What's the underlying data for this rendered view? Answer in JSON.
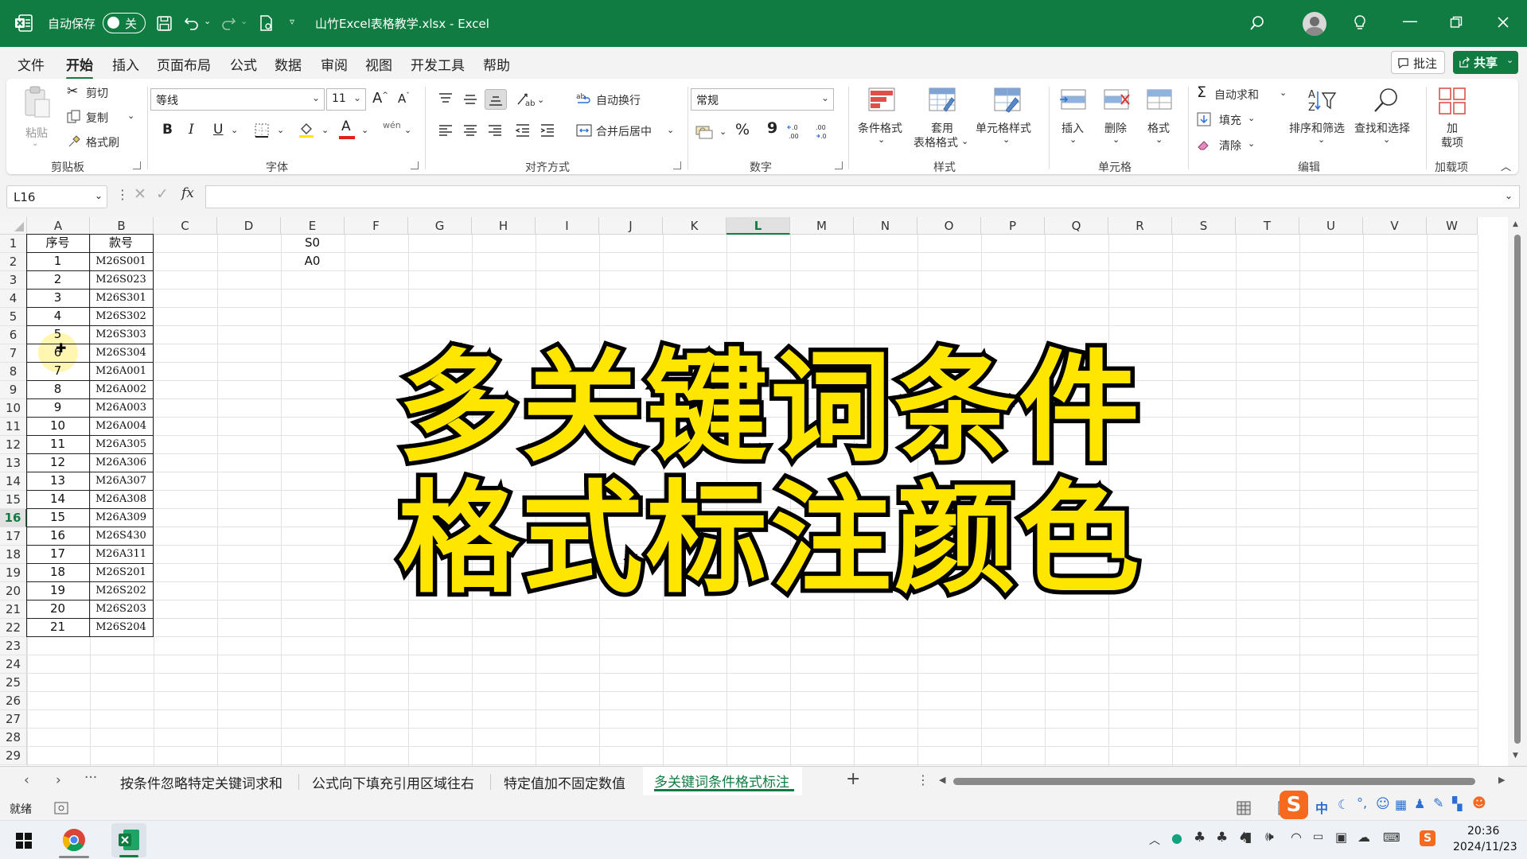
{
  "window": {
    "autosave_label": "自动保存",
    "autosave_state": "关",
    "file_title": "山竹Excel表格教学.xlsx  -  Excel"
  },
  "menu": [
    "文件",
    "开始",
    "插入",
    "页面布局",
    "公式",
    "数据",
    "审阅",
    "视图",
    "开发工具",
    "帮助"
  ],
  "menu_right": {
    "comment": "批注",
    "share": "共享"
  },
  "ribbon": {
    "clipboard": {
      "paste": "粘贴",
      "cut": "剪切",
      "copy": "复制",
      "format_painter": "格式刷",
      "group": "剪贴板"
    },
    "font": {
      "name": "等线",
      "size": "11",
      "bold": "B",
      "italic": "I",
      "underline": "U",
      "wen": "wén",
      "group": "字体"
    },
    "alignment": {
      "wrap": "自动换行",
      "merge": "合并后居中",
      "group": "对齐方式"
    },
    "number": {
      "format": "常规",
      "percent": "%",
      "comma": "9",
      "group": "数字"
    },
    "styles": {
      "conditional": "条件格式",
      "table_l1": "套用",
      "table_l2": "表格格式",
      "cell_styles": "单元格样式",
      "group": "样式"
    },
    "cells": {
      "insert": "插入",
      "delete": "删除",
      "format": "格式",
      "group": "单元格"
    },
    "editing": {
      "autosum": "自动求和",
      "fill": "填充",
      "clear": "清除",
      "sort": "排序和筛选",
      "find": "查找和选择",
      "group": "编辑"
    },
    "addins": {
      "label_l1": "加",
      "label_l2": "载项",
      "group": "加载项"
    }
  },
  "formula_bar": {
    "name_box": "L16",
    "fx": "fx",
    "content": ""
  },
  "columns": [
    "A",
    "B",
    "C",
    "D",
    "E",
    "F",
    "G",
    "H",
    "I",
    "J",
    "K",
    "L",
    "M",
    "N",
    "O",
    "P",
    "Q",
    "R",
    "S",
    "T",
    "U",
    "V",
    "W"
  ],
  "selected_column": "L",
  "selected_row": 16,
  "rows": [
    "1",
    "2",
    "3",
    "4",
    "5",
    "6",
    "7",
    "8",
    "9",
    "10",
    "11",
    "12",
    "13",
    "14",
    "15",
    "16",
    "17",
    "18",
    "19",
    "20",
    "21",
    "22",
    "23",
    "24",
    "25",
    "26",
    "27",
    "28",
    "29"
  ],
  "table": {
    "headers": [
      "序号",
      "款号"
    ],
    "seq": [
      "1",
      "2",
      "3",
      "4",
      "5",
      "6",
      "7",
      "8",
      "9",
      "10",
      "11",
      "12",
      "13",
      "14",
      "15",
      "16",
      "17",
      "18",
      "19",
      "20",
      "21"
    ],
    "codes": [
      "M26S001",
      "M26S023",
      "M26S301",
      "M26S302",
      "M26S303",
      "M26S304",
      "M26A001",
      "M26A002",
      "M26A003",
      "M26A004",
      "M26A305",
      "M26A306",
      "M26A307",
      "M26A308",
      "M26A309",
      "M26S430",
      "M26A311",
      "M26S201",
      "M26S202",
      "M26S203",
      "M26S204"
    ]
  },
  "keywords": [
    "S0",
    "A0"
  ],
  "overlay": {
    "line1": "多关键词条件",
    "line2": "格式标注颜色"
  },
  "sheet_tabs": [
    "按条件忽略特定关键词求和",
    "公式向下填充引用区域往右",
    "特定值加不固定数值",
    "多关键词条件格式标注"
  ],
  "active_sheet_index": 3,
  "status": {
    "ready": "就绪"
  },
  "taskbar": {
    "time": "20:36",
    "date": "2024/11/23",
    "ime": "中"
  },
  "colors": {
    "excel_green": "#107c41",
    "overlay_fill": "#ffe600",
    "overlay_stroke": "#000000",
    "highlight": "#fff6a8"
  }
}
